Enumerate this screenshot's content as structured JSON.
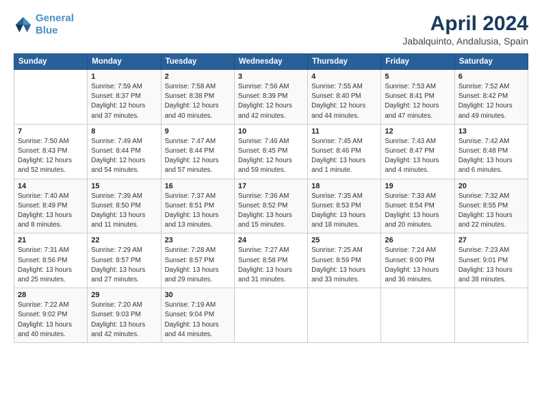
{
  "logo": {
    "line1": "General",
    "line2": "Blue"
  },
  "title": "April 2024",
  "subtitle": "Jabalquinto, Andalusia, Spain",
  "days_of_week": [
    "Sunday",
    "Monday",
    "Tuesday",
    "Wednesday",
    "Thursday",
    "Friday",
    "Saturday"
  ],
  "weeks": [
    [
      {
        "num": "",
        "info": ""
      },
      {
        "num": "1",
        "info": "Sunrise: 7:59 AM\nSunset: 8:37 PM\nDaylight: 12 hours\nand 37 minutes."
      },
      {
        "num": "2",
        "info": "Sunrise: 7:58 AM\nSunset: 8:38 PM\nDaylight: 12 hours\nand 40 minutes."
      },
      {
        "num": "3",
        "info": "Sunrise: 7:56 AM\nSunset: 8:39 PM\nDaylight: 12 hours\nand 42 minutes."
      },
      {
        "num": "4",
        "info": "Sunrise: 7:55 AM\nSunset: 8:40 PM\nDaylight: 12 hours\nand 44 minutes."
      },
      {
        "num": "5",
        "info": "Sunrise: 7:53 AM\nSunset: 8:41 PM\nDaylight: 12 hours\nand 47 minutes."
      },
      {
        "num": "6",
        "info": "Sunrise: 7:52 AM\nSunset: 8:42 PM\nDaylight: 12 hours\nand 49 minutes."
      }
    ],
    [
      {
        "num": "7",
        "info": "Sunrise: 7:50 AM\nSunset: 8:43 PM\nDaylight: 12 hours\nand 52 minutes."
      },
      {
        "num": "8",
        "info": "Sunrise: 7:49 AM\nSunset: 8:44 PM\nDaylight: 12 hours\nand 54 minutes."
      },
      {
        "num": "9",
        "info": "Sunrise: 7:47 AM\nSunset: 8:44 PM\nDaylight: 12 hours\nand 57 minutes."
      },
      {
        "num": "10",
        "info": "Sunrise: 7:46 AM\nSunset: 8:45 PM\nDaylight: 12 hours\nand 59 minutes."
      },
      {
        "num": "11",
        "info": "Sunrise: 7:45 AM\nSunset: 8:46 PM\nDaylight: 13 hours\nand 1 minute."
      },
      {
        "num": "12",
        "info": "Sunrise: 7:43 AM\nSunset: 8:47 PM\nDaylight: 13 hours\nand 4 minutes."
      },
      {
        "num": "13",
        "info": "Sunrise: 7:42 AM\nSunset: 8:48 PM\nDaylight: 13 hours\nand 6 minutes."
      }
    ],
    [
      {
        "num": "14",
        "info": "Sunrise: 7:40 AM\nSunset: 8:49 PM\nDaylight: 13 hours\nand 8 minutes."
      },
      {
        "num": "15",
        "info": "Sunrise: 7:39 AM\nSunset: 8:50 PM\nDaylight: 13 hours\nand 11 minutes."
      },
      {
        "num": "16",
        "info": "Sunrise: 7:37 AM\nSunset: 8:51 PM\nDaylight: 13 hours\nand 13 minutes."
      },
      {
        "num": "17",
        "info": "Sunrise: 7:36 AM\nSunset: 8:52 PM\nDaylight: 13 hours\nand 15 minutes."
      },
      {
        "num": "18",
        "info": "Sunrise: 7:35 AM\nSunset: 8:53 PM\nDaylight: 13 hours\nand 18 minutes."
      },
      {
        "num": "19",
        "info": "Sunrise: 7:33 AM\nSunset: 8:54 PM\nDaylight: 13 hours\nand 20 minutes."
      },
      {
        "num": "20",
        "info": "Sunrise: 7:32 AM\nSunset: 8:55 PM\nDaylight: 13 hours\nand 22 minutes."
      }
    ],
    [
      {
        "num": "21",
        "info": "Sunrise: 7:31 AM\nSunset: 8:56 PM\nDaylight: 13 hours\nand 25 minutes."
      },
      {
        "num": "22",
        "info": "Sunrise: 7:29 AM\nSunset: 8:57 PM\nDaylight: 13 hours\nand 27 minutes."
      },
      {
        "num": "23",
        "info": "Sunrise: 7:28 AM\nSunset: 8:57 PM\nDaylight: 13 hours\nand 29 minutes."
      },
      {
        "num": "24",
        "info": "Sunrise: 7:27 AM\nSunset: 8:58 PM\nDaylight: 13 hours\nand 31 minutes."
      },
      {
        "num": "25",
        "info": "Sunrise: 7:25 AM\nSunset: 8:59 PM\nDaylight: 13 hours\nand 33 minutes."
      },
      {
        "num": "26",
        "info": "Sunrise: 7:24 AM\nSunset: 9:00 PM\nDaylight: 13 hours\nand 36 minutes."
      },
      {
        "num": "27",
        "info": "Sunrise: 7:23 AM\nSunset: 9:01 PM\nDaylight: 13 hours\nand 38 minutes."
      }
    ],
    [
      {
        "num": "28",
        "info": "Sunrise: 7:22 AM\nSunset: 9:02 PM\nDaylight: 13 hours\nand 40 minutes."
      },
      {
        "num": "29",
        "info": "Sunrise: 7:20 AM\nSunset: 9:03 PM\nDaylight: 13 hours\nand 42 minutes."
      },
      {
        "num": "30",
        "info": "Sunrise: 7:19 AM\nSunset: 9:04 PM\nDaylight: 13 hours\nand 44 minutes."
      },
      {
        "num": "",
        "info": ""
      },
      {
        "num": "",
        "info": ""
      },
      {
        "num": "",
        "info": ""
      },
      {
        "num": "",
        "info": ""
      }
    ]
  ]
}
